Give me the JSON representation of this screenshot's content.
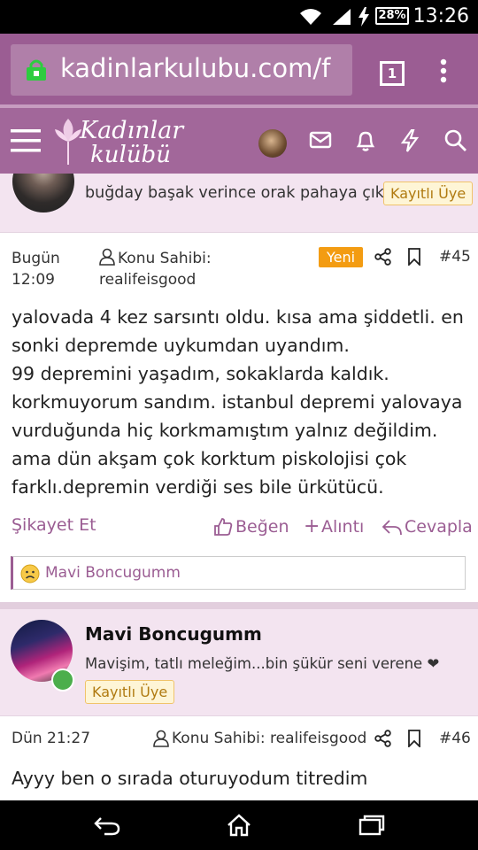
{
  "status_bar": {
    "battery": "28%",
    "time": "13:26"
  },
  "browser": {
    "url": "kadinlarkulubu.com/f",
    "tab_count": "1"
  },
  "site": {
    "logo_line1": "Kadınlar",
    "logo_line2": "kulübü"
  },
  "post1": {
    "signature": "buğday başak verince orak pahaya çıkar..",
    "badge": "Kayıtlı Üye",
    "date_line1": "Bugün",
    "date_line2": "12:09",
    "owner_label": "Konu Sahibi:",
    "owner_name": "realifeisgood",
    "new_badge": "Yeni",
    "number": "#45",
    "body": "yalovada 4 kez sarsıntı oldu. kısa ama şiddetli. en sonki depremde uykumdan uyandım.\n99 depremini yaşadım, sokaklarda kaldık. korkmuyorum sandım. istanbul depremi yalovaya vurduğunda hiç korkmamıştım yalnız değildim. ama dün akşam çok korktum piskolojisi çok farklı.depremin verdiği ses bile ürkütücü.",
    "report": "Şikayet Et",
    "like": "Beğen",
    "quote": "Alıntı",
    "reply": "Cevapla",
    "reaction_user": "Mavi Boncugumm"
  },
  "post2": {
    "username": "Mavi Boncugumm",
    "signature": "Mavişim, tatlı meleğim...bin şükür seni verene ❤",
    "badge": "Kayıtlı Üye",
    "date": "Dün 21:27",
    "owner": "Konu Sahibi: realifeisgood",
    "number": "#46",
    "body_line1": "Ayyy ben o sırada oturuyodum titredim"
  },
  "colors": {
    "brand": "#9b5d93",
    "header": "#a2679a",
    "post_bg": "#f3e4f0",
    "new_badge": "#f39c12"
  }
}
